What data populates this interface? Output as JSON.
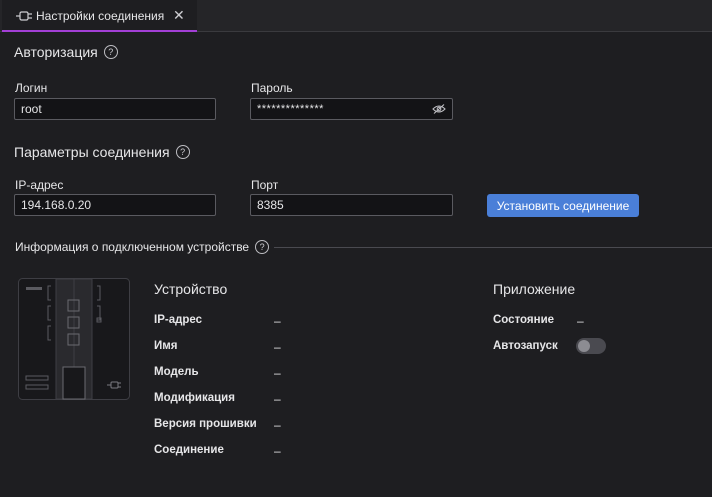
{
  "tab": {
    "label": "Настройки соединения",
    "close": "✕",
    "icon": "plug-icon"
  },
  "auth": {
    "title": "Авторизация",
    "help": "?",
    "login_label": "Логин",
    "login_value": "root",
    "password_label": "Пароль",
    "password_value": "**************"
  },
  "connection": {
    "title": "Параметры соединения",
    "help": "?",
    "ip_label": "IP-адрес",
    "ip_value": "194.168.0.20",
    "port_label": "Порт",
    "port_value": "8385",
    "connect_label": "Установить соединение"
  },
  "device_info": {
    "title": "Информация о подключенном устройстве",
    "help": "?",
    "device_heading": "Устройство",
    "device_props": [
      {
        "label": "IP-адрес",
        "value": "–"
      },
      {
        "label": "Имя",
        "value": "–"
      },
      {
        "label": "Модель",
        "value": "–"
      },
      {
        "label": "Модификация",
        "value": "–"
      },
      {
        "label": "Версия прошивки",
        "value": "–"
      },
      {
        "label": "Соединение",
        "value": "–"
      }
    ],
    "app_heading": "Приложение",
    "state_label": "Состояние",
    "state_value": "–",
    "autostart_label": "Автозапуск",
    "autostart_on": false
  },
  "colors": {
    "accent": "#a33fd6",
    "button": "#4a7fd8",
    "background": "#1e1e21"
  }
}
